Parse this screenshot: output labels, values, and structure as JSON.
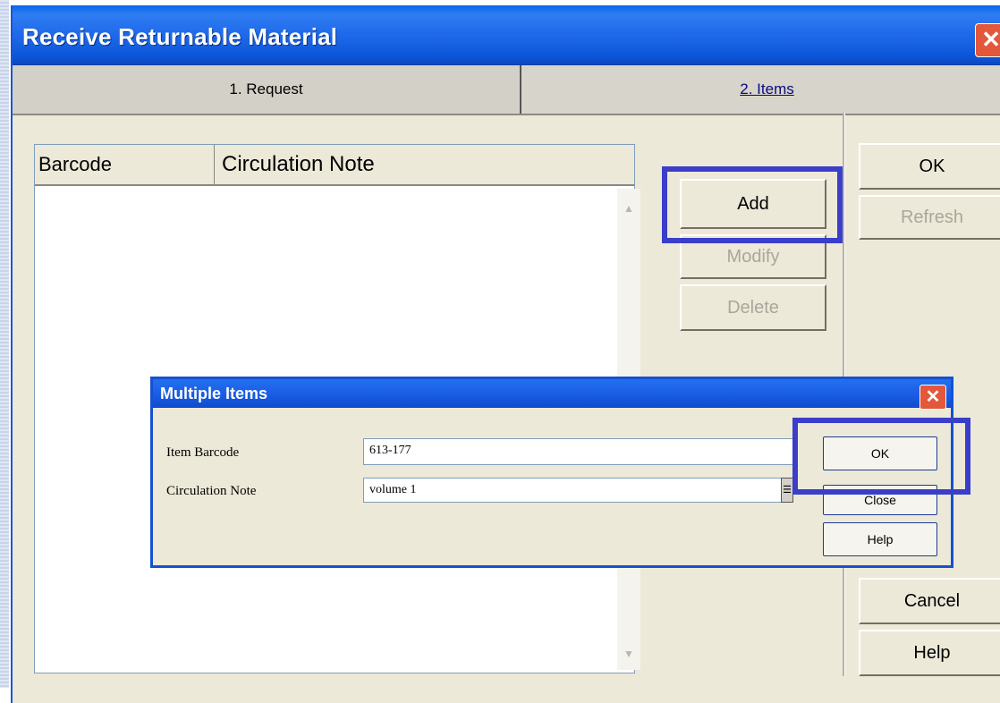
{
  "window": {
    "title": "Receive Returnable Material",
    "close_glyph": "✕"
  },
  "tabs": [
    {
      "label": "1. Request"
    },
    {
      "label": "2. Items"
    }
  ],
  "grid": {
    "columns": [
      "Barcode",
      "Circulation Note"
    ],
    "rows": []
  },
  "item_buttons": {
    "add": "Add",
    "modify": "Modify",
    "delete": "Delete"
  },
  "side_buttons": {
    "ok": "OK",
    "refresh": "Refresh",
    "cancel": "Cancel",
    "help": "Help"
  },
  "dialog": {
    "title": "Multiple Items",
    "close_glyph": "✕",
    "fields": [
      {
        "label": "Item Barcode",
        "value": "613-177"
      },
      {
        "label": "Circulation Note",
        "value": "volume 1"
      }
    ],
    "buttons": {
      "ok": "OK",
      "close": "Close",
      "help": "Help"
    }
  },
  "colors": {
    "highlight": "#3a3ec9",
    "titlebar": "#1f69ea",
    "dialog_border": "#1451d0"
  },
  "icons": {
    "scroll_up": "▲",
    "scroll_down": "▼",
    "dropdown": "☰"
  }
}
